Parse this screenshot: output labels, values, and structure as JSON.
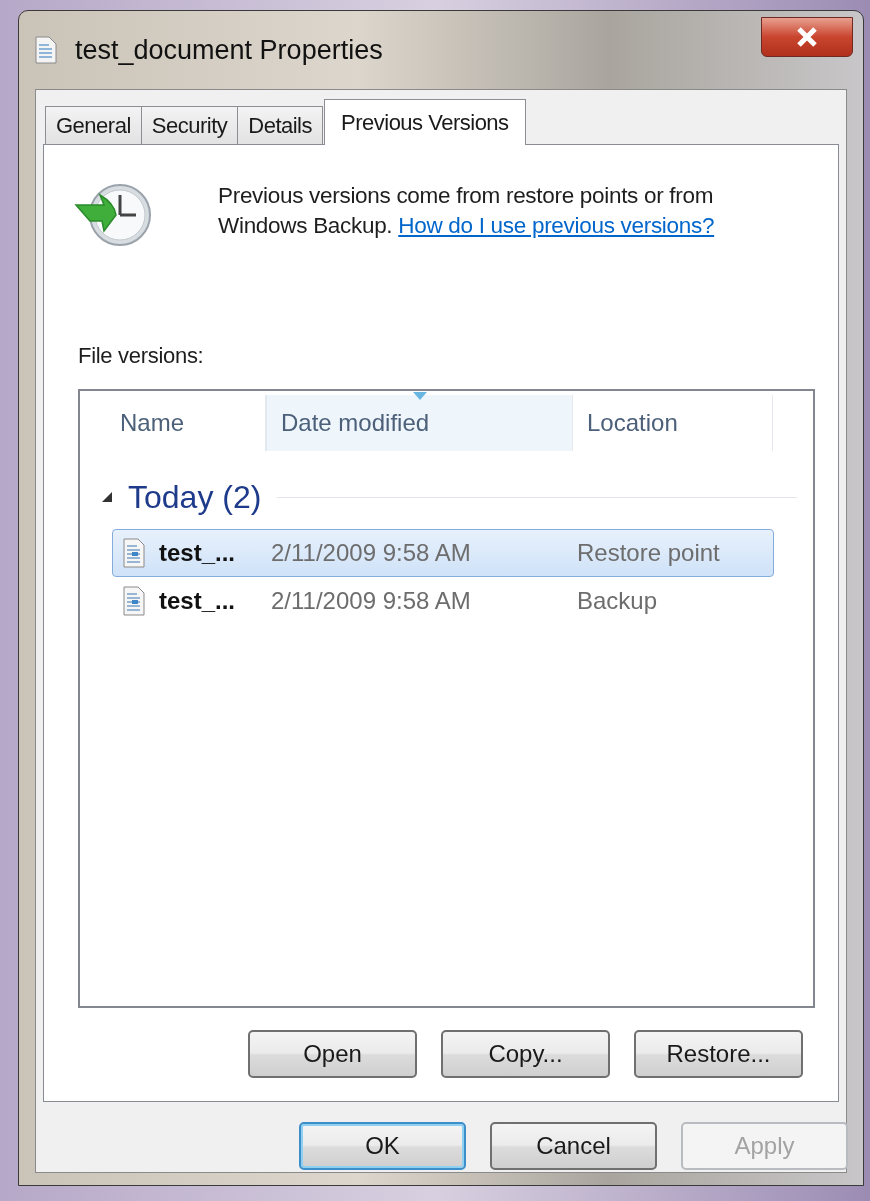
{
  "window": {
    "title": "test_document Properties"
  },
  "tabs": [
    {
      "label": "General",
      "selected": false
    },
    {
      "label": "Security",
      "selected": false
    },
    {
      "label": "Details",
      "selected": false
    },
    {
      "label": "Previous Versions",
      "selected": true
    }
  ],
  "description": {
    "text": "Previous versions come from restore points or from Windows Backup.",
    "link": "How do I use previous versions?"
  },
  "file_versions_label": "File versions:",
  "columns": [
    {
      "label": "Name",
      "sorted": false
    },
    {
      "label": "Date modified",
      "sorted": true
    },
    {
      "label": "Location",
      "sorted": false
    }
  ],
  "group": {
    "label": "Today (2)",
    "expanded": true,
    "rows": [
      {
        "name": "test_...",
        "date": "2/11/2009 9:58 AM",
        "location": "Restore point",
        "selected": true
      },
      {
        "name": "test_...",
        "date": "2/11/2009 9:58 AM",
        "location": "Backup",
        "selected": false
      }
    ]
  },
  "actions": [
    {
      "label": "Open",
      "disabled": false
    },
    {
      "label": "Copy...",
      "disabled": false
    },
    {
      "label": "Restore...",
      "disabled": false
    }
  ],
  "dialog_buttons": [
    {
      "label": "OK",
      "default": true,
      "disabled": false
    },
    {
      "label": "Cancel",
      "default": false,
      "disabled": false
    },
    {
      "label": "Apply",
      "default": false,
      "disabled": true
    }
  ]
}
